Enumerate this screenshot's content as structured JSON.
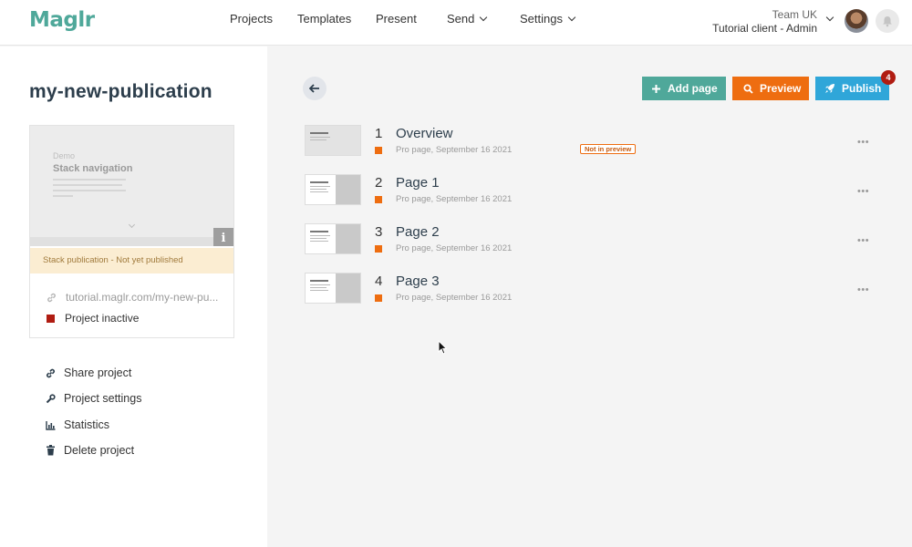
{
  "brand": {
    "logo_text": "Maglr",
    "accent": "#4fa89a"
  },
  "nav": {
    "projects": "Projects",
    "templates": "Templates",
    "present": "Present",
    "send": "Send",
    "settings": "Settings"
  },
  "account": {
    "team": "Team UK",
    "client": "Tutorial client - Admin"
  },
  "publication": {
    "title": "my-new-publication",
    "preview_kicker": "Demo",
    "preview_heading": "Stack navigation",
    "status_text": "Stack publication - Not yet published",
    "url": "tutorial.maglr.com/my-new-pu...",
    "project_status": "Project inactive"
  },
  "sidebar_menu": [
    {
      "label": "Share project",
      "icon": "link-icon"
    },
    {
      "label": "Project settings",
      "icon": "wrench-icon"
    },
    {
      "label": "Statistics",
      "icon": "chart-icon"
    },
    {
      "label": "Delete project",
      "icon": "trash-icon"
    }
  ],
  "toolbar": {
    "add_page": "Add page",
    "preview": "Preview",
    "publish": "Publish",
    "publish_badge": "4"
  },
  "pages": [
    {
      "num": "1",
      "title": "Overview",
      "meta": "Pro page, September 16 2021",
      "tag": "Not in preview"
    },
    {
      "num": "2",
      "title": "Page 1",
      "meta": "Pro page, September 16 2021",
      "tag": ""
    },
    {
      "num": "3",
      "title": "Page 2",
      "meta": "Pro page, September 16 2021",
      "tag": ""
    },
    {
      "num": "4",
      "title": "Page 3",
      "meta": "Pro page, September 16 2021",
      "tag": ""
    }
  ],
  "colors": {
    "add": "#4fa89a",
    "preview": "#ee6d10",
    "publish": "#2fa6d9",
    "badge": "#b01c12",
    "inactive": "#b01c12"
  }
}
